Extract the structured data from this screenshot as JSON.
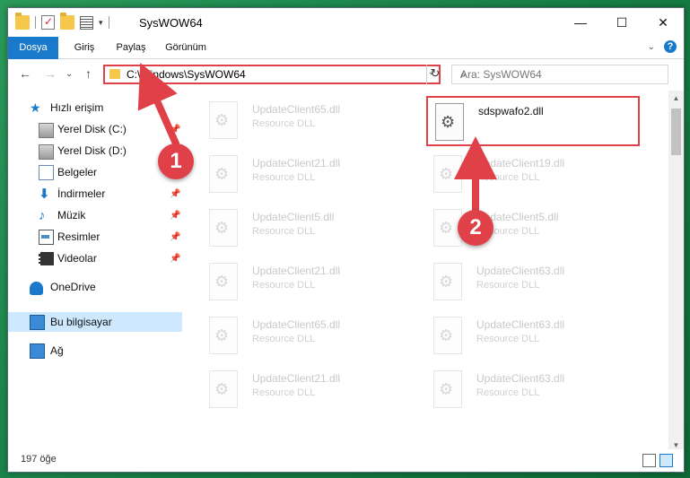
{
  "window": {
    "title": "SysWOW64",
    "minimize_glyph": "—",
    "maximize_glyph": "☐",
    "close_glyph": "✕"
  },
  "ribbon": {
    "tabs": [
      "Dosya",
      "Giriş",
      "Paylaş",
      "Görünüm"
    ],
    "expand_glyph": "⌄",
    "help_glyph": "?"
  },
  "nav": {
    "back_glyph": "←",
    "forward_glyph": "→",
    "recent_glyph": "⌄",
    "up_glyph": "↑",
    "address": "C:\\Windows\\SysWOW64",
    "refresh_glyph": "↻",
    "search_placeholder": "Ara: SysWOW64"
  },
  "sidebar": {
    "quick_access": "Hızlı erişim",
    "pinned": [
      {
        "label": "Yerel Disk (C:)",
        "icon": "drive-icon"
      },
      {
        "label": "Yerel Disk (D:)",
        "icon": "drive-icon"
      },
      {
        "label": "Belgeler",
        "icon": "documents-icon"
      },
      {
        "label": "İndirmeler",
        "icon": "downloads-icon"
      },
      {
        "label": "Müzik",
        "icon": "music-icon"
      },
      {
        "label": "Resimler",
        "icon": "pictures-icon"
      },
      {
        "label": "Videolar",
        "icon": "videos-icon"
      }
    ],
    "onedrive": "OneDrive",
    "this_pc": "Bu bilgisayar",
    "network": "Ağ"
  },
  "files": {
    "left": [
      {
        "name": "UpdateClient65.dll",
        "desc": "Resource DLL"
      },
      {
        "name": "UpdateClient21.dll",
        "desc": "Resource DLL"
      },
      {
        "name": "UpdateClient5.dll",
        "desc": "Resource DLL"
      },
      {
        "name": "UpdateClient21.dll",
        "desc": "Resource DLL"
      },
      {
        "name": "UpdateClient65.dll",
        "desc": "Resource DLL"
      },
      {
        "name": "UpdateClient21.dll",
        "desc": "Resource DLL"
      }
    ],
    "right": [
      {
        "name": "sdspwafo2.dll",
        "desc": ""
      },
      {
        "name": "UpdateClient19.dll",
        "desc": "Resource DLL"
      },
      {
        "name": "UpdateClient5.dll",
        "desc": "Resource DLL"
      },
      {
        "name": "UpdateClient63.dll",
        "desc": "Resource DLL"
      },
      {
        "name": "UpdateClient63.dll",
        "desc": "Resource DLL"
      },
      {
        "name": "UpdateClient63.dll",
        "desc": "Resource DLL"
      }
    ]
  },
  "status": {
    "item_count": "197 öğe"
  },
  "annotations": {
    "step1": "1",
    "step2": "2",
    "color": "#e04048"
  },
  "colors": {
    "accent": "#1979ca",
    "highlight": "#e04048",
    "selection": "#cde8ff"
  }
}
